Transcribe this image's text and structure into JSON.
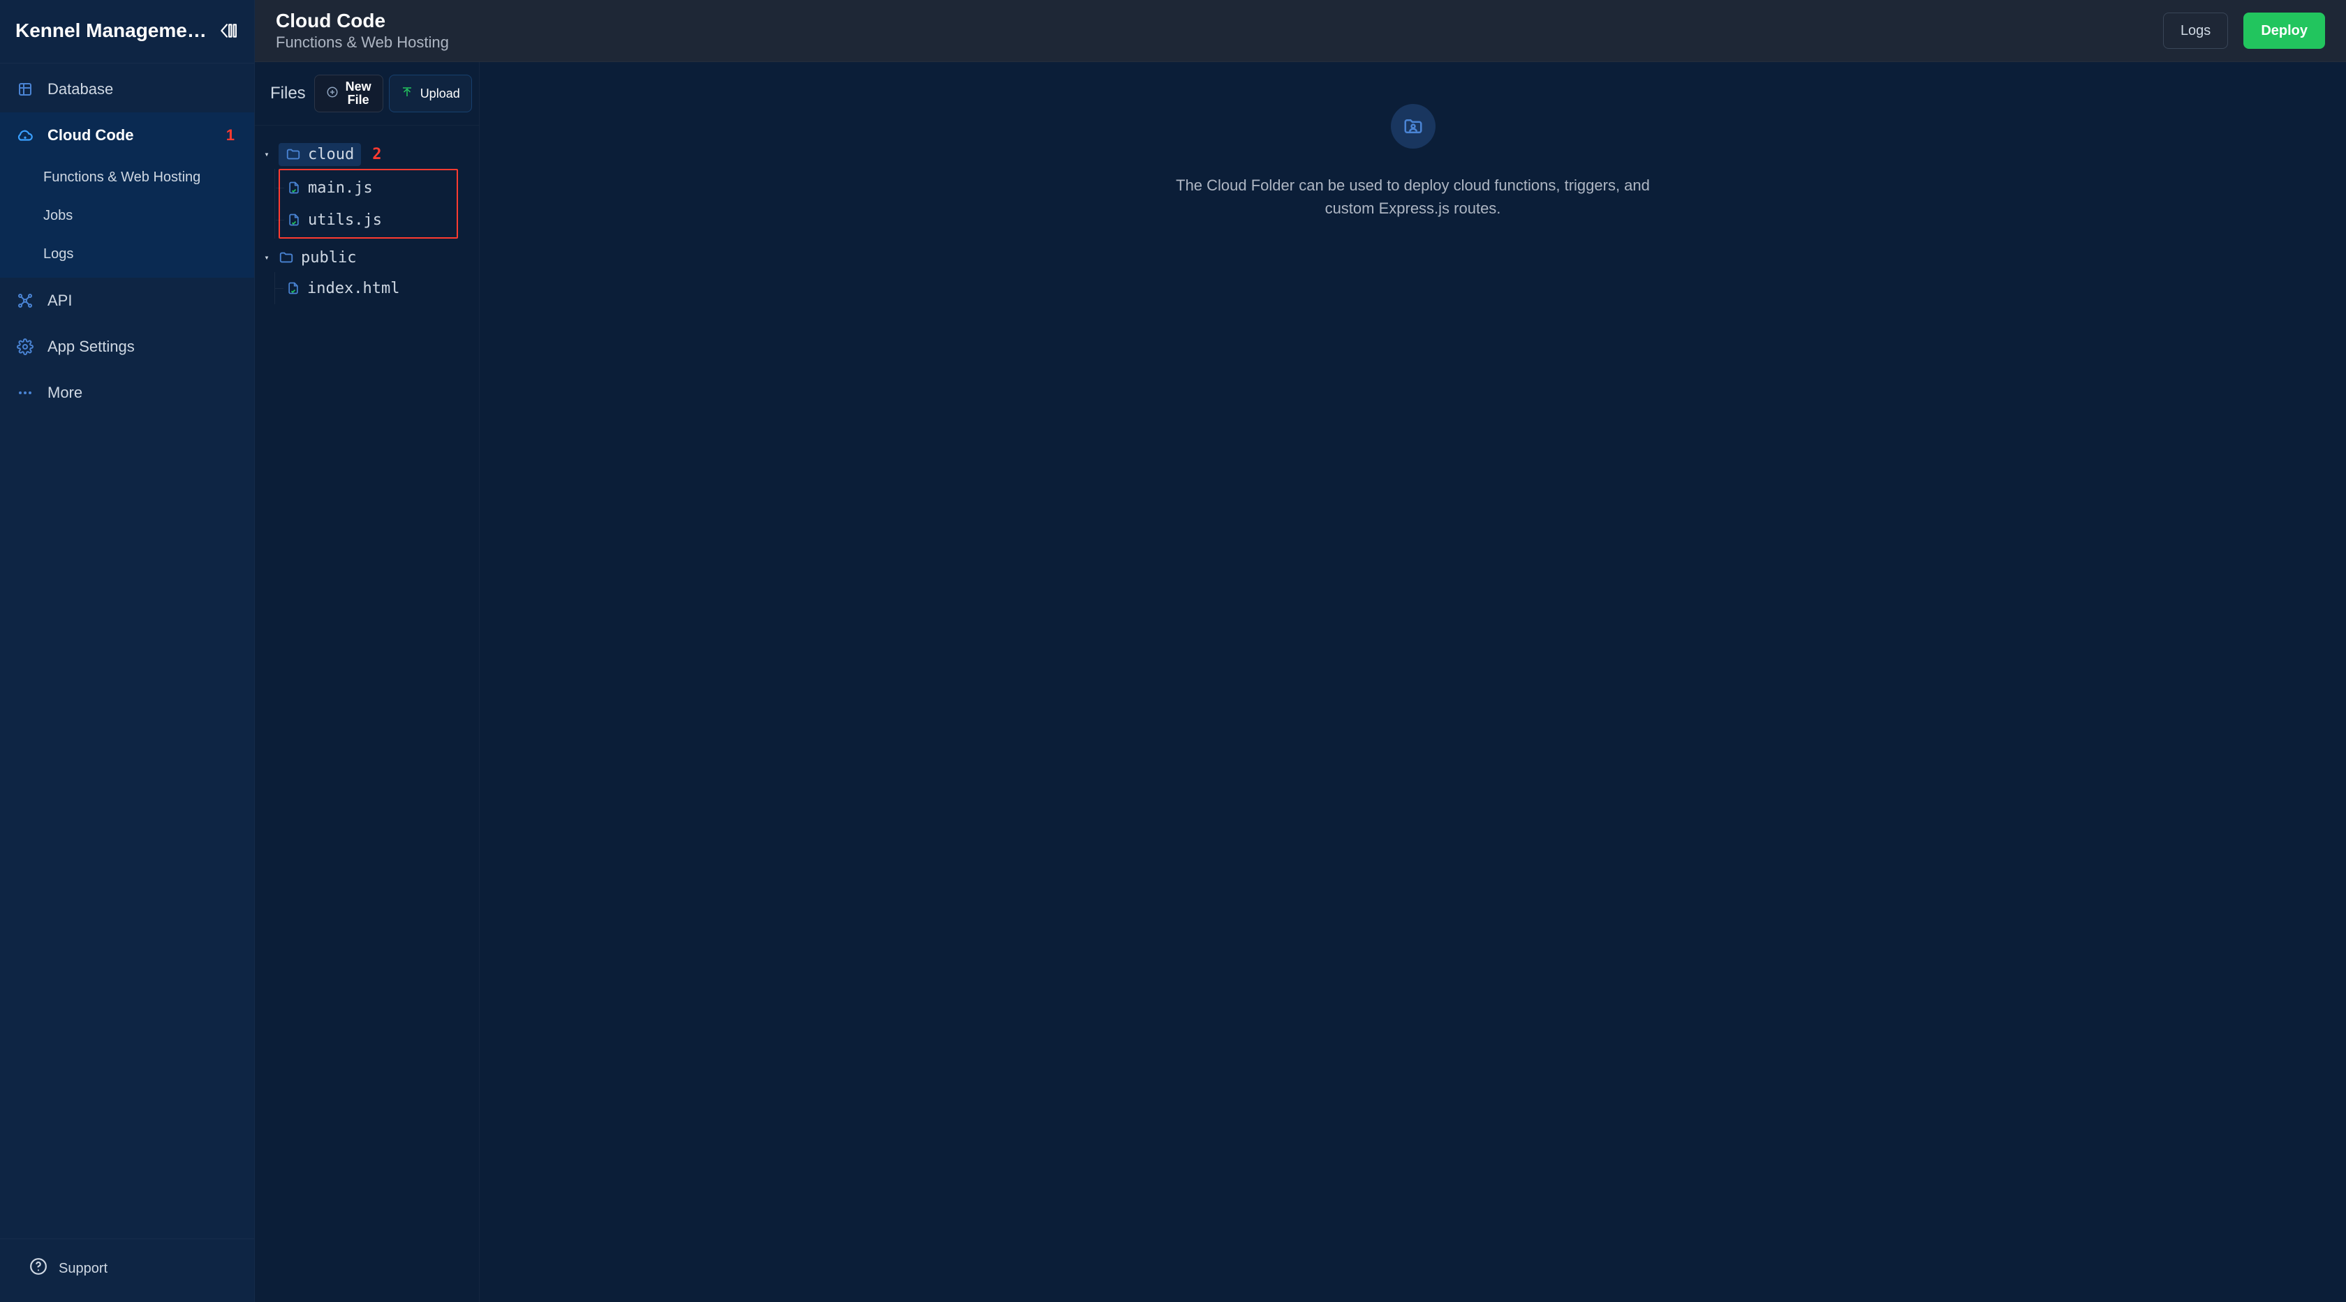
{
  "app": {
    "title": "Kennel Management ..."
  },
  "sidebar": {
    "items": [
      {
        "label": "Database"
      },
      {
        "label": "Cloud Code",
        "badge": "1"
      },
      {
        "label": "API"
      },
      {
        "label": "App Settings"
      },
      {
        "label": "More"
      }
    ],
    "cloud_code_sub": [
      "Functions & Web Hosting",
      "Jobs",
      "Logs"
    ],
    "support_label": "Support"
  },
  "header": {
    "title": "Cloud Code",
    "subtitle": "Functions & Web Hosting",
    "logs_label": "Logs",
    "deploy_label": "Deploy"
  },
  "files_panel": {
    "title": "Files",
    "new_file_line1": "New",
    "new_file_line2": "File",
    "upload_label": "Upload",
    "tree": [
      {
        "type": "folder",
        "name": "cloud",
        "badge": "2",
        "children": [
          {
            "type": "file",
            "name": "main.js"
          },
          {
            "type": "file",
            "name": "utils.js"
          }
        ]
      },
      {
        "type": "folder",
        "name": "public",
        "children": [
          {
            "type": "file",
            "name": "index.html"
          }
        ]
      }
    ]
  },
  "detail": {
    "message": "The Cloud Folder can be used to deploy cloud functions, triggers, and custom Express.js routes."
  }
}
